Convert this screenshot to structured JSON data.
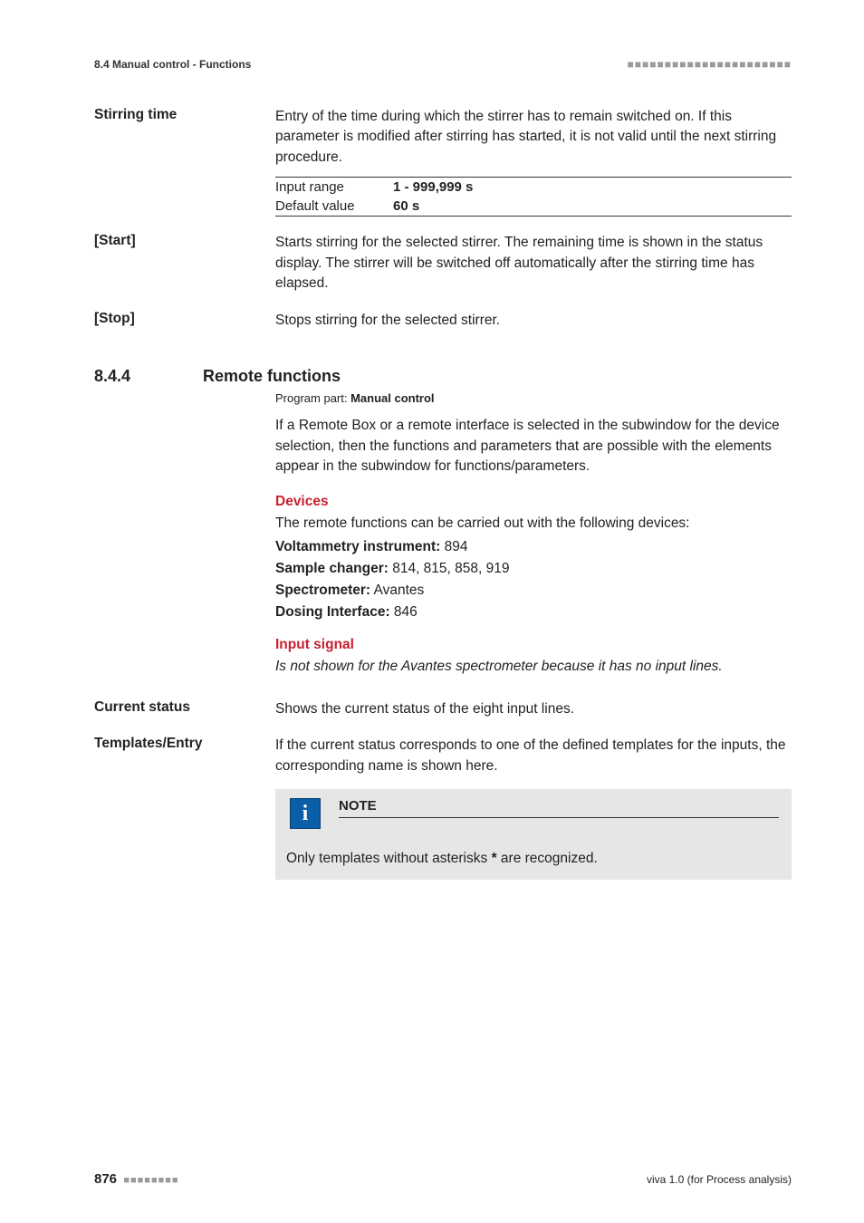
{
  "header": {
    "left": "8.4 Manual control - Functions",
    "dots": "■■■■■■■■■■■■■■■■■■■■■■"
  },
  "stirring_time": {
    "label": "Stirring time",
    "desc": "Entry of the time during which the stirrer has to remain switched on. If this parameter is modified after stirring has started, it is not valid until the next stirring procedure.",
    "input_range_key": "Input range",
    "input_range_val": "1 - 999,999 s",
    "default_key": "Default value",
    "default_val": "60 s"
  },
  "start": {
    "label": "[Start]",
    "desc": "Starts stirring for the selected stirrer. The remaining time is shown in the status display. The stirrer will be switched off automatically after the stirring time has elapsed."
  },
  "stop": {
    "label": "[Stop]",
    "desc": "Stops stirring for the selected stirrer."
  },
  "section": {
    "num": "8.4.4",
    "title": "Remote functions",
    "program_part_prefix": "Program part: ",
    "program_part_value": "Manual control",
    "intro": "If a Remote Box or a remote interface is selected in the subwindow for the device selection, then the functions and parameters that are possible with the elements appear in the subwindow for functions/parameters.",
    "devices_head": "Devices",
    "devices_intro": "The remote functions can be carried out with the following devices:",
    "dev1_label": "Voltammetry instrument:",
    "dev1_val": " 894",
    "dev2_label": "Sample changer:",
    "dev2_val": " 814, 815, 858, 919",
    "dev3_label": "Spectrometer:",
    "dev3_val": " Avantes",
    "dev4_label": "Dosing Interface:",
    "dev4_val": " 846",
    "input_signal_head": "Input signal",
    "input_signal_note": "Is not shown for the Avantes spectrometer because it has no input lines."
  },
  "current_status": {
    "label": "Current status",
    "desc": "Shows the current status of the eight input lines."
  },
  "templates_entry": {
    "label": "Templates/Entry",
    "desc": "If the current status corresponds to one of the defined templates for the inputs, the corresponding name is shown here.",
    "note_title": "NOTE",
    "note_body_pre": "Only templates without asterisks ",
    "note_body_bold": "*",
    "note_body_post": " are recognized."
  },
  "footer": {
    "page": "876",
    "dots": "■■■■■■■■",
    "right": "viva 1.0 (for Process analysis)"
  }
}
